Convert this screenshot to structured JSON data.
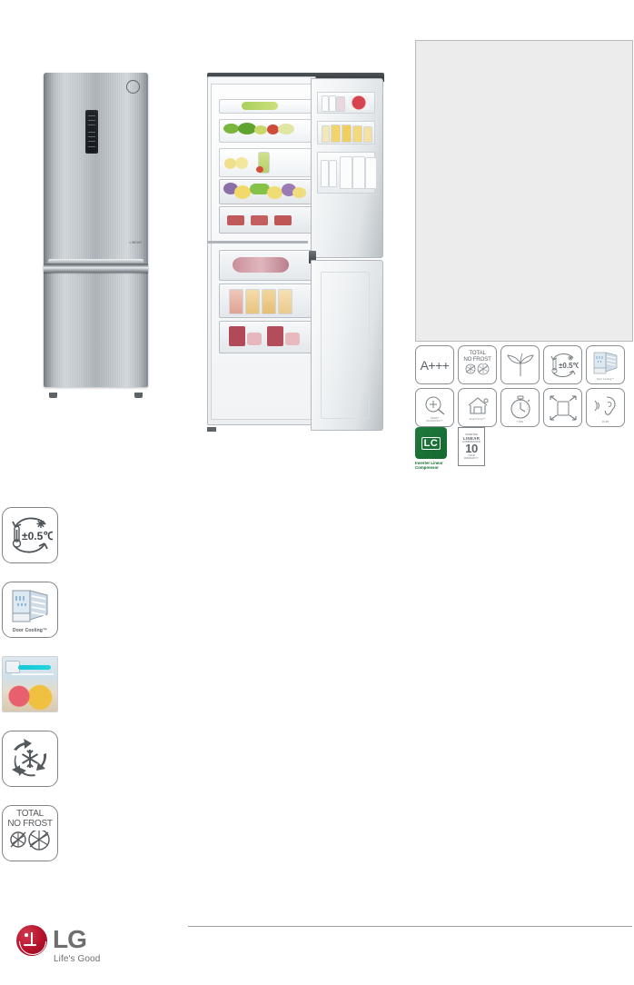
{
  "page": {
    "brand": "LG",
    "tagline": "Life's Good",
    "logo_color": "#b3102a",
    "logo_text_color": "#6e6e6e"
  },
  "product_images": {
    "closed": {
      "name": "LG bottom-freezer refrigerator, doors closed, stainless finish",
      "panel_label": "display-panel",
      "door_badge": "LINEAR",
      "logo": "LG"
    },
    "open": {
      "name": "LG bottom-freezer refrigerator, doors open showing food",
      "compartments": [
        "fridge",
        "freezer"
      ]
    }
  },
  "spec_placeholder": {
    "label": "specification-panel",
    "fill": "#ececec",
    "border": "#b9b9b9"
  },
  "feature_grid": {
    "rows": [
      [
        {
          "id": "energy-rating",
          "text": "A+++",
          "caption": ""
        },
        {
          "id": "total-no-frost",
          "text": "TOTAL\nNO FROST",
          "caption": ""
        },
        {
          "id": "fresh-converter",
          "text": "",
          "caption": ""
        },
        {
          "id": "precise-temp",
          "text": "±0.5℃",
          "caption": ""
        },
        {
          "id": "door-cooling",
          "text": "",
          "caption": "Door Cooling™"
        }
      ],
      [
        {
          "id": "smart-diagnosis",
          "text": "",
          "caption": "SMART\nDIAGNOSIS™"
        },
        {
          "id": "smart-thinq",
          "text": "",
          "caption": "SmartThinQ™"
        },
        {
          "id": "fast-freeze",
          "text": "",
          "caption": "7 MIN"
        },
        {
          "id": "big-capacity",
          "text": "",
          "caption": ""
        },
        {
          "id": "low-noise",
          "text": "",
          "caption": "36 dB"
        }
      ]
    ]
  },
  "badges": {
    "compressor": {
      "mark": "LC",
      "label": "Inverter Linear\nCompressor",
      "color": "#15692f"
    },
    "warranty": {
      "top": "INVERTER",
      "line": "LINEAR",
      "sub": "COMPRESSOR",
      "years": "10",
      "year_label": "YEAR",
      "bottom": "WARRANTY"
    }
  },
  "feature_column": {
    "items": [
      {
        "id": "precise-temp-control",
        "name": "precise-temperature-icon",
        "caption": "",
        "value": "±0.5℃"
      },
      {
        "id": "door-cooling",
        "name": "door-cooling-icon",
        "caption": "Door Cooling™",
        "value": ""
      },
      {
        "id": "fresh-food-photo",
        "name": "fresh-food-thumbnail",
        "caption": "",
        "value": ""
      },
      {
        "id": "multi-air-flow",
        "name": "multi-air-flow-icon",
        "caption": "",
        "value": ""
      },
      {
        "id": "total-no-frost",
        "name": "total-no-frost-icon",
        "caption": "",
        "value": "TOTAL\nNO FROST"
      }
    ]
  },
  "footer": {
    "rule": true
  }
}
